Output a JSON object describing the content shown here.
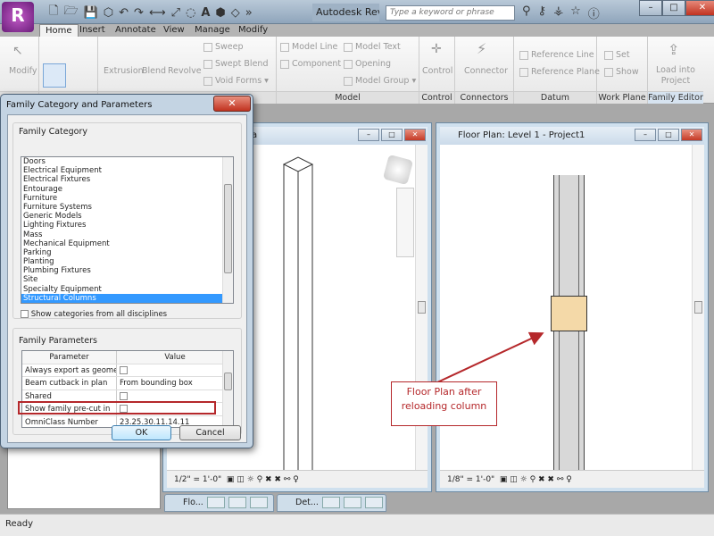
{
  "app": {
    "logo": "R",
    "title": "Autodesk Revit ...",
    "search_placeholder": "Type a keyword or phrase",
    "quick_access_icons": [
      "new-icon",
      "open-icon",
      "save-icon",
      "sync-icon",
      "undo-icon",
      "redo-icon",
      "measure-icon",
      "dimension-icon",
      "tag-icon",
      "text-icon",
      "3d-view-icon",
      "section-icon"
    ],
    "right_icons": [
      "binoculars-icon",
      "key-icon",
      "satellite-icon",
      "star-icon",
      "help-icon"
    ]
  },
  "tabs": [
    "Home",
    "Insert",
    "Annotate",
    "View",
    "Manage",
    "Modify"
  ],
  "ribbon": {
    "select": {
      "modify": "Modify"
    },
    "forms": {
      "extrusion": "Extrusion",
      "blend": "Blend",
      "revolve": "Revolve",
      "sweep": "Sweep",
      "swept_blend": "Swept Blend",
      "void_forms": "Void Forms"
    },
    "model": {
      "model_line": "Model Line",
      "component": "Component",
      "model_text": "Model Text",
      "opening": "Opening",
      "model_group": "Model Group",
      "label": "Model"
    },
    "control": {
      "button": "Control",
      "label": "Control"
    },
    "connectors": {
      "button": "Connector",
      "label": "Connectors"
    },
    "datum": {
      "reference_line": "Reference Line",
      "reference_plane": "Reference Plane",
      "label": "Datum"
    },
    "work_plane": {
      "set": "Set",
      "show": "Show",
      "label": "Work Plane"
    },
    "family_editor": {
      "load_line1": "Load into",
      "load_line2": "Project",
      "label": "Family Editor"
    }
  },
  "views": {
    "left": {
      "title": "nber-Column.rfa",
      "scale": "1/2\" = 1'-0\""
    },
    "right": {
      "title": "Floor Plan: Level 1 - Project1",
      "scale": "1/8\" = 1'-0\""
    }
  },
  "minimized": [
    {
      "label": "Flo..."
    },
    {
      "label": "Det..."
    }
  ],
  "status": "Ready",
  "dialog": {
    "title": "Family Category and Parameters",
    "category_group": "Family Category",
    "categories": [
      "Doors",
      "Electrical Equipment",
      "Electrical Fixtures",
      "Entourage",
      "Furniture",
      "Furniture Systems",
      "Generic Models",
      "Lighting Fixtures",
      "Mass",
      "Mechanical Equipment",
      "Parking",
      "Planting",
      "Plumbing Fixtures",
      "Site",
      "Specialty Equipment",
      "Structural Columns"
    ],
    "selected_category": "Structural Columns",
    "show_all_label": "Show categories from all disciplines",
    "show_all_checked": false,
    "params_group": "Family Parameters",
    "columns": [
      "Parameter",
      "Value"
    ],
    "params": [
      {
        "name": "Always export as geome",
        "value": "",
        "checkbox": true,
        "checked": false
      },
      {
        "name": "Beam cutback in plan",
        "value": "From bounding box",
        "checkbox": false
      },
      {
        "name": "Shared",
        "value": "",
        "checkbox": true,
        "checked": false
      },
      {
        "name": "Show family pre-cut in",
        "value": "",
        "checkbox": true,
        "checked": false
      },
      {
        "name": "OmniClass Number",
        "value": "23.25.30.11.14.11",
        "checkbox": false
      }
    ],
    "ok": "OK",
    "cancel": "Cancel"
  },
  "annotation": {
    "line1": "Floor Plan after",
    "line2": "reloading column",
    "color": "#b5282b"
  }
}
